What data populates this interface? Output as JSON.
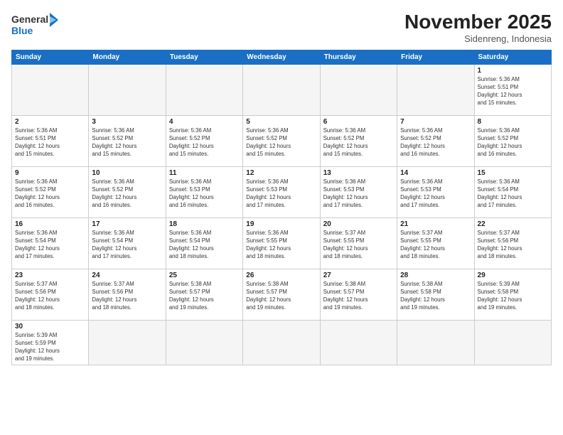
{
  "logo": {
    "line1": "General",
    "line2": "Blue"
  },
  "title": "November 2025",
  "location": "Sidenreng, Indonesia",
  "weekdays": [
    "Sunday",
    "Monday",
    "Tuesday",
    "Wednesday",
    "Thursday",
    "Friday",
    "Saturday"
  ],
  "days": [
    {
      "num": "",
      "info": ""
    },
    {
      "num": "",
      "info": ""
    },
    {
      "num": "",
      "info": ""
    },
    {
      "num": "",
      "info": ""
    },
    {
      "num": "",
      "info": ""
    },
    {
      "num": "",
      "info": ""
    },
    {
      "num": "1",
      "info": "Sunrise: 5:36 AM\nSunset: 5:51 PM\nDaylight: 12 hours\nand 15 minutes."
    },
    {
      "num": "2",
      "info": "Sunrise: 5:36 AM\nSunset: 5:51 PM\nDaylight: 12 hours\nand 15 minutes."
    },
    {
      "num": "3",
      "info": "Sunrise: 5:36 AM\nSunset: 5:52 PM\nDaylight: 12 hours\nand 15 minutes."
    },
    {
      "num": "4",
      "info": "Sunrise: 5:36 AM\nSunset: 5:52 PM\nDaylight: 12 hours\nand 15 minutes."
    },
    {
      "num": "5",
      "info": "Sunrise: 5:36 AM\nSunset: 5:52 PM\nDaylight: 12 hours\nand 15 minutes."
    },
    {
      "num": "6",
      "info": "Sunrise: 5:36 AM\nSunset: 5:52 PM\nDaylight: 12 hours\nand 15 minutes."
    },
    {
      "num": "7",
      "info": "Sunrise: 5:36 AM\nSunset: 5:52 PM\nDaylight: 12 hours\nand 16 minutes."
    },
    {
      "num": "8",
      "info": "Sunrise: 5:36 AM\nSunset: 5:52 PM\nDaylight: 12 hours\nand 16 minutes."
    },
    {
      "num": "9",
      "info": "Sunrise: 5:36 AM\nSunset: 5:52 PM\nDaylight: 12 hours\nand 16 minutes."
    },
    {
      "num": "10",
      "info": "Sunrise: 5:36 AM\nSunset: 5:52 PM\nDaylight: 12 hours\nand 16 minutes."
    },
    {
      "num": "11",
      "info": "Sunrise: 5:36 AM\nSunset: 5:53 PM\nDaylight: 12 hours\nand 16 minutes."
    },
    {
      "num": "12",
      "info": "Sunrise: 5:36 AM\nSunset: 5:53 PM\nDaylight: 12 hours\nand 17 minutes."
    },
    {
      "num": "13",
      "info": "Sunrise: 5:36 AM\nSunset: 5:53 PM\nDaylight: 12 hours\nand 17 minutes."
    },
    {
      "num": "14",
      "info": "Sunrise: 5:36 AM\nSunset: 5:53 PM\nDaylight: 12 hours\nand 17 minutes."
    },
    {
      "num": "15",
      "info": "Sunrise: 5:36 AM\nSunset: 5:54 PM\nDaylight: 12 hours\nand 17 minutes."
    },
    {
      "num": "16",
      "info": "Sunrise: 5:36 AM\nSunset: 5:54 PM\nDaylight: 12 hours\nand 17 minutes."
    },
    {
      "num": "17",
      "info": "Sunrise: 5:36 AM\nSunset: 5:54 PM\nDaylight: 12 hours\nand 17 minutes."
    },
    {
      "num": "18",
      "info": "Sunrise: 5:36 AM\nSunset: 5:54 PM\nDaylight: 12 hours\nand 18 minutes."
    },
    {
      "num": "19",
      "info": "Sunrise: 5:36 AM\nSunset: 5:55 PM\nDaylight: 12 hours\nand 18 minutes."
    },
    {
      "num": "20",
      "info": "Sunrise: 5:37 AM\nSunset: 5:55 PM\nDaylight: 12 hours\nand 18 minutes."
    },
    {
      "num": "21",
      "info": "Sunrise: 5:37 AM\nSunset: 5:55 PM\nDaylight: 12 hours\nand 18 minutes."
    },
    {
      "num": "22",
      "info": "Sunrise: 5:37 AM\nSunset: 5:56 PM\nDaylight: 12 hours\nand 18 minutes."
    },
    {
      "num": "23",
      "info": "Sunrise: 5:37 AM\nSunset: 5:56 PM\nDaylight: 12 hours\nand 18 minutes."
    },
    {
      "num": "24",
      "info": "Sunrise: 5:37 AM\nSunset: 5:56 PM\nDaylight: 12 hours\nand 18 minutes."
    },
    {
      "num": "25",
      "info": "Sunrise: 5:38 AM\nSunset: 5:57 PM\nDaylight: 12 hours\nand 19 minutes."
    },
    {
      "num": "26",
      "info": "Sunrise: 5:38 AM\nSunset: 5:57 PM\nDaylight: 12 hours\nand 19 minutes."
    },
    {
      "num": "27",
      "info": "Sunrise: 5:38 AM\nSunset: 5:57 PM\nDaylight: 12 hours\nand 19 minutes."
    },
    {
      "num": "28",
      "info": "Sunrise: 5:38 AM\nSunset: 5:58 PM\nDaylight: 12 hours\nand 19 minutes."
    },
    {
      "num": "29",
      "info": "Sunrise: 5:39 AM\nSunset: 5:58 PM\nDaylight: 12 hours\nand 19 minutes."
    },
    {
      "num": "30",
      "info": "Sunrise: 5:39 AM\nSunset: 5:59 PM\nDaylight: 12 hours\nand 19 minutes."
    },
    {
      "num": "",
      "info": ""
    },
    {
      "num": "",
      "info": ""
    },
    {
      "num": "",
      "info": ""
    },
    {
      "num": "",
      "info": ""
    },
    {
      "num": "",
      "info": ""
    },
    {
      "num": "",
      "info": ""
    }
  ]
}
